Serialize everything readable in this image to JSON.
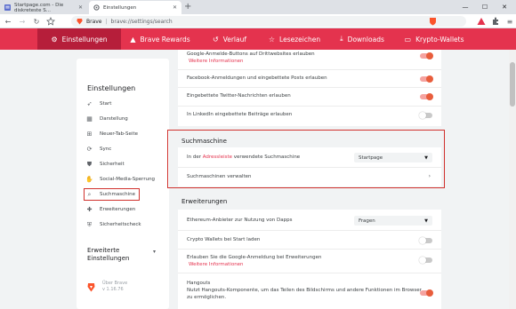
{
  "tabs": [
    {
      "title": "Startpage.com - Die diskreteste S..."
    },
    {
      "title": "Einstellungen"
    }
  ],
  "window": {
    "minimize": "—",
    "maximize": "☐",
    "close": "✕"
  },
  "address": {
    "brand": "Brave",
    "url": "brave://settings/search"
  },
  "nav": [
    {
      "label": "Einstellungen",
      "icon": "gear-icon",
      "glyph": "⚙",
      "active": true
    },
    {
      "label": "Brave Rewards",
      "icon": "triangle-icon",
      "glyph": "▲"
    },
    {
      "label": "Verlauf",
      "icon": "history-icon",
      "glyph": "↺"
    },
    {
      "label": "Lesezeichen",
      "icon": "bookmark-icon",
      "glyph": "☆"
    },
    {
      "label": "Downloads",
      "icon": "download-icon",
      "glyph": "⤓"
    },
    {
      "label": "Krypto-Wallets",
      "icon": "wallet-icon",
      "glyph": "▭"
    }
  ],
  "sidebar": {
    "title": "Einstellungen",
    "items": [
      {
        "label": "Start",
        "icon": "rocket-icon",
        "glyph": "➶"
      },
      {
        "label": "Darstellung",
        "icon": "appearance-icon",
        "glyph": "▦"
      },
      {
        "label": "Neuer-Tab-Seite",
        "icon": "new-tab-icon",
        "glyph": "⊞"
      },
      {
        "label": "Sync",
        "icon": "sync-icon",
        "glyph": "⟳"
      },
      {
        "label": "Sicherheit",
        "icon": "shield-icon",
        "glyph": "⛊"
      },
      {
        "label": "Social-Media-Sperrung",
        "icon": "thumb-icon",
        "glyph": "✋"
      },
      {
        "label": "Suchmaschine",
        "icon": "search-icon",
        "glyph": "⌕"
      },
      {
        "label": "Erweiterungen",
        "icon": "puzzle-icon",
        "glyph": "✚"
      },
      {
        "label": "Sicherheitscheck",
        "icon": "security-check-icon",
        "glyph": "⛨"
      }
    ],
    "advanced_line1": "Erweiterte",
    "advanced_line2": "Einstellungen",
    "about_line1": "Über Brave",
    "about_line2": "v 1.16.76"
  },
  "social": {
    "google_buttons": "Google-Anmelde-Buttons auf Drittwebsites erlauben",
    "google_more": "Weitere Informationen",
    "facebook": "Facebook-Anmeldungen und eingebettete Posts erlauben",
    "twitter": "Eingebettete Twitter-Nachrichten erlauben",
    "linkedin": "In LinkedIn eingebettete Beiträge erlauben"
  },
  "search": {
    "title": "Suchmaschine",
    "row_prefix": "In der ",
    "row_link": "Adressleiste",
    "row_suffix": " verwendete Suchmaschine",
    "engine": "Startpage",
    "manage": "Suchmaschinen verwalten"
  },
  "extensions": {
    "title": "Erweiterungen",
    "ethereum": "Ethereum-Anbieter zur Nutzung von Dapps",
    "ethereum_value": "Fragen",
    "crypto_wallets": "Crypto Wallets bei Start laden",
    "google_login": "Erlauben Sie die Google-Anmeldung bei Erweiterungen",
    "google_login_more": "Weitere Informationen",
    "hangouts_title": "Hangouts",
    "hangouts_desc1": "Nutzt Hangouts-Komponente, um das Teilen des Bildschirms und andere Funktionen im Browser",
    "hangouts_desc2": "zu ermöglichen."
  },
  "colors": {
    "brand_red": "#e4334e",
    "active_nav": "#b61e3a",
    "highlight": "#d0312d"
  }
}
